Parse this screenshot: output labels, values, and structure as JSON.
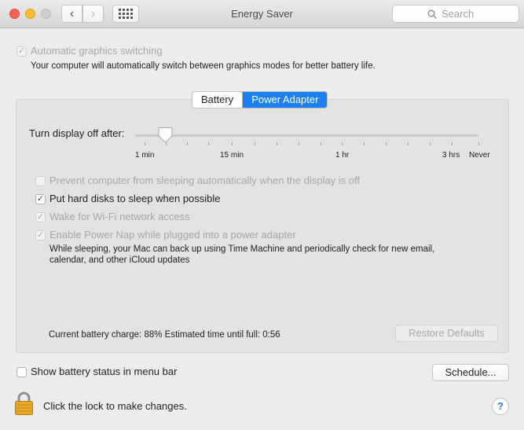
{
  "window": {
    "title": "Energy Saver",
    "search_placeholder": "Search"
  },
  "graphics": {
    "auto_switching_label": "Automatic graphics switching",
    "auto_switching_checked": true,
    "auto_switching_desc": "Your computer will automatically switch between graphics modes for better battery life."
  },
  "tabs": [
    {
      "label": "Battery",
      "active": false
    },
    {
      "label": "Power Adapter",
      "active": true
    }
  ],
  "display_sleep": {
    "label": "Turn display off after:",
    "ticks": [
      "1 min",
      "15 min",
      "1 hr",
      "3 hrs",
      "Never"
    ]
  },
  "options": [
    {
      "label": "Prevent computer from sleeping automatically when the display is off",
      "checked": false,
      "enabled": true
    },
    {
      "label": "Put hard disks to sleep when possible",
      "checked": true,
      "enabled": true
    },
    {
      "label": "Wake for Wi-Fi network access",
      "checked": true,
      "enabled": false
    },
    {
      "label": "Enable Power Nap while plugged into a power adapter",
      "checked": true,
      "enabled": false
    }
  ],
  "power_nap_desc_line1": "While sleeping, your Mac can back up using Time Machine and periodically check for new email,",
  "power_nap_desc_line2": "calendar, and other iCloud updates",
  "status": {
    "battery_charge": "Current battery charge: 88%  Estimated time until full: 0:56"
  },
  "buttons": {
    "restore_defaults": "Restore Defaults",
    "schedule": "Schedule..."
  },
  "menu_bar": {
    "label": "Show battery status in menu bar",
    "checked": false
  },
  "lock": {
    "label": "Click the lock to make changes."
  },
  "help": "?",
  "icons": {
    "check": "✓",
    "back": "‹",
    "forward": "›"
  },
  "colors": {
    "accent": "#1b80f2"
  }
}
